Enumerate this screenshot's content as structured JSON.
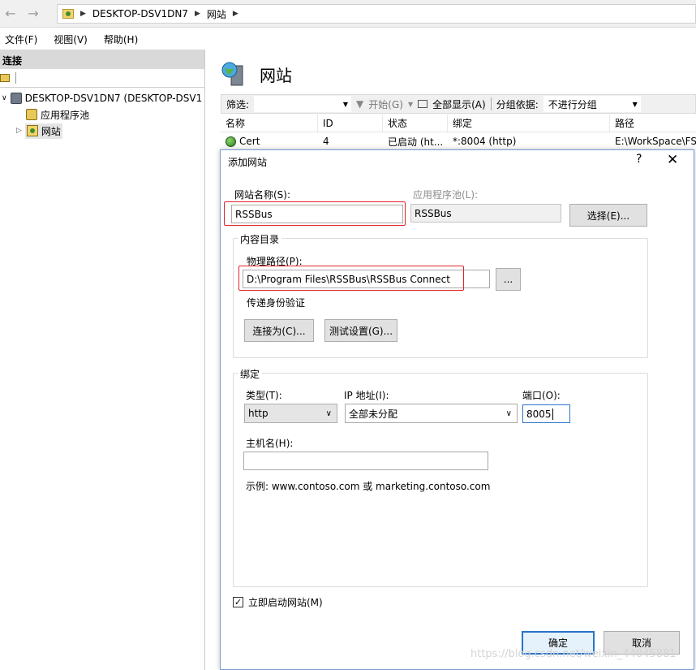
{
  "address": {
    "crumbs": [
      "DESKTOP-DSV1DN7",
      "网站"
    ]
  },
  "menu": [
    "文件(F)",
    "视图(V)",
    "帮助(H)"
  ],
  "connections": {
    "header": "连接",
    "tree": {
      "server": "DESKTOP-DSV1DN7 (DESKTOP-DSV1",
      "app_pools": "应用程序池",
      "sites": "网站"
    }
  },
  "sites_page": {
    "title": "网站",
    "filter_label": "筛选:",
    "start_btn": "开始(G)",
    "show_all_btn": "全部显示(A)",
    "group_by_label": "分组依据:",
    "group_by_value": "不进行分组",
    "columns": [
      "名称",
      "ID",
      "状态",
      "绑定",
      "路径"
    ],
    "rows": [
      {
        "name": "Cert",
        "id": "4",
        "status": "已启动 (ht...",
        "binding": "*:8004 (http)",
        "path": "E:\\WorkSpace\\FS"
      }
    ]
  },
  "dialog": {
    "title": "添加网站",
    "help": "?",
    "close": "✕",
    "site_name_label": "网站名称(S):",
    "site_name_value": "RSSBus",
    "app_pool_label": "应用程序池(L):",
    "app_pool_value": "RSSBus",
    "select_btn": "选择(E)...",
    "content_dir_title": "内容目录",
    "physical_path_label": "物理路径(P):",
    "physical_path_value": "D:\\Program Files\\RSSBus\\RSSBus Connect",
    "browse_btn": "...",
    "pass_through_label": "传递身份验证",
    "connect_as_btn": "连接为(C)...",
    "test_settings_btn": "测试设置(G)...",
    "binding_title": "绑定",
    "type_label": "类型(T):",
    "type_value": "http",
    "ip_label": "IP 地址(I):",
    "ip_value": "全部未分配",
    "port_label": "端口(O):",
    "port_value": "8005",
    "host_label": "主机名(H):",
    "host_value": "",
    "example_text": "示例: www.contoso.com 或 marketing.contoso.com",
    "start_immediately_label": "立即启动网站(M)",
    "start_immediately_checked": true,
    "ok_btn": "确定",
    "cancel_btn": "取消"
  },
  "watermark": "https://blog.csdn.net/weixin_44045881"
}
